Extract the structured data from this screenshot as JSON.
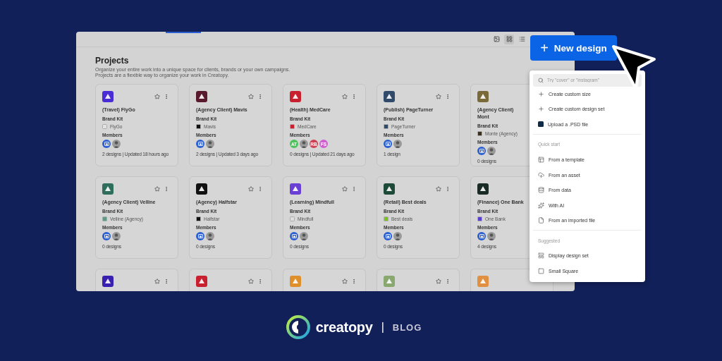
{
  "toolbar": [
    {
      "kind": "image",
      "selected": false
    },
    {
      "kind": "grid",
      "selected": true
    },
    {
      "kind": "list",
      "selected": false
    }
  ],
  "page": {
    "title": "Projects",
    "description": [
      "Organize your entire work into a unique space for clients, brands or your own campaigns.",
      "Projects are a flexible way to organize your work in Creatopy."
    ]
  },
  "projects": [
    {
      "title": "(Travel) FlyGo",
      "color": "#4a2bd6",
      "brand_kit_label": "Brand Kit",
      "brand_kit": {
        "name": "FlyGo",
        "color": "#e2e2e2"
      },
      "members_label": "Members",
      "members": [
        {
          "kind": "team"
        },
        {
          "kind": "photo"
        }
      ],
      "footer": "2 designs | Updated 18 hours ago"
    },
    {
      "title": "(Agency Client) Mavis",
      "color": "#5a1a2e",
      "brand_kit_label": "Brand Kit",
      "brand_kit": {
        "name": "Mavis",
        "color": "#111111"
      },
      "members_label": "Members",
      "members": [
        {
          "kind": "team"
        },
        {
          "kind": "photo"
        }
      ],
      "footer": "2 designs | Updated 3 days ago"
    },
    {
      "title": "(Health) MedCare",
      "color": "#c8202e",
      "brand_kit_label": "Brand Kit",
      "brand_kit": {
        "name": "MedCare",
        "color": "#c8202e"
      },
      "members_label": "Members",
      "members": [
        {
          "kind": "initials",
          "initials": "AT",
          "color": "#4cc35a"
        },
        {
          "kind": "photo"
        },
        {
          "kind": "initials",
          "initials": "RB",
          "color": "#d04050"
        },
        {
          "kind": "initials",
          "initials": "FS",
          "color": "#d060d0"
        }
      ],
      "footer": "0 designs | Updated 21 days ago"
    },
    {
      "title": "(Publish) PageTurner",
      "color": "#2f4a6a",
      "brand_kit_label": "Brand Kit",
      "brand_kit": {
        "name": "PageTurner",
        "color": "#2d4a6e"
      },
      "members_label": "Members",
      "members": [
        {
          "kind": "team"
        },
        {
          "kind": "photo"
        }
      ],
      "footer": "1 design"
    },
    {
      "title": "(Agency Client) Mont",
      "color": "#7a6a3a",
      "brand_kit_label": "Brand Kit",
      "brand_kit": {
        "name": "Monte (Agency)",
        "color": "#3a3020"
      },
      "members_label": "Members",
      "members": [
        {
          "kind": "team"
        },
        {
          "kind": "photo"
        }
      ],
      "footer": "0 designs"
    },
    {
      "title": "(Agency Client) Velline",
      "color": "#2f6e5c",
      "brand_kit_label": "Brand Kit",
      "brand_kit": {
        "name": "Velline (Agency)",
        "color": "#5f9a86"
      },
      "members_label": "Members",
      "members": [
        {
          "kind": "team"
        },
        {
          "kind": "photo"
        }
      ],
      "footer": "0 designs"
    },
    {
      "title": "(Agency) Halfstar",
      "color": "#111111",
      "brand_kit_label": "Brand Kit",
      "brand_kit": {
        "name": "Halfstar",
        "color": "#111111"
      },
      "members_label": "Members",
      "members": [
        {
          "kind": "team"
        },
        {
          "kind": "photo"
        }
      ],
      "footer": "0 designs"
    },
    {
      "title": "(Learning) Mindfull",
      "color": "#6a3fd6",
      "brand_kit_label": "Brand Kit",
      "brand_kit": {
        "name": "Mindfull",
        "color": "#dedede"
      },
      "members_label": "Members",
      "members": [
        {
          "kind": "team"
        },
        {
          "kind": "photo"
        }
      ],
      "footer": "0 designs"
    },
    {
      "title": "(Retail) Best deals",
      "color": "#1e4a3a",
      "brand_kit_label": "Brand Kit",
      "brand_kit": {
        "name": "Best deals",
        "color": "#7bc41f"
      },
      "members_label": "Members",
      "members": [
        {
          "kind": "team"
        },
        {
          "kind": "photo"
        }
      ],
      "footer": "0 designs"
    },
    {
      "title": "(Finance) One Bank",
      "color": "#1a2a24",
      "brand_kit_label": "Brand Kit",
      "brand_kit": {
        "name": "One Bank",
        "color": "#5a3fd0"
      },
      "members_label": "Members",
      "members": [
        {
          "kind": "team"
        },
        {
          "kind": "photo"
        }
      ],
      "footer": "4 designs"
    },
    {
      "color": "#3a20b0"
    },
    {
      "color": "#c8202e"
    },
    {
      "color": "#e0902a"
    },
    {
      "color": "#88a870"
    },
    {
      "color": "#e09040"
    }
  ],
  "new_design": {
    "icon": "+",
    "label": "New design"
  },
  "menu": {
    "search": {
      "placeholder": "Try \"cover\" or \"instagram\""
    },
    "sections": [
      {
        "items": [
          {
            "kind": "plus",
            "label": "Create custom size"
          },
          {
            "kind": "plus",
            "label": "Create custom design set"
          },
          {
            "kind": "psd",
            "label": "Upload a .PSD file"
          }
        ]
      },
      {
        "title": "Quick start",
        "items": [
          {
            "kind": "template",
            "label": "From a template"
          },
          {
            "kind": "upload",
            "label": "From an asset"
          },
          {
            "kind": "data",
            "label": "From data"
          },
          {
            "kind": "ai",
            "label": "With AI"
          },
          {
            "kind": "file",
            "label": "From an imported file"
          }
        ]
      },
      {
        "title": "Suggested",
        "items": [
          {
            "kind": "set",
            "label": "Display design set"
          },
          {
            "kind": "square",
            "label": "Small Square"
          }
        ]
      }
    ]
  },
  "brand": {
    "name": "creatopy",
    "separator": "|",
    "section": "BLOG"
  }
}
